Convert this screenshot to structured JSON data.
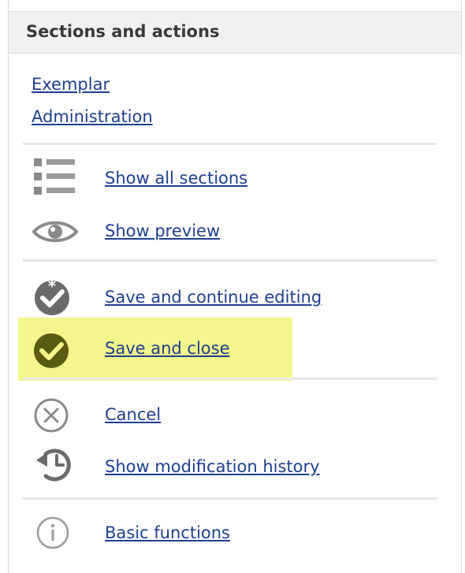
{
  "panel": {
    "title": "Sections and actions"
  },
  "links": {
    "exemplar": "Exemplar",
    "administration": "Administration"
  },
  "actions": {
    "show_all_sections": "Show all sections",
    "show_preview": "Show preview",
    "save_and_continue": "Save and continue editing",
    "save_and_close": "Save and close",
    "cancel": "Cancel",
    "show_modification_history": "Show modification history",
    "basic_functions": "Basic functions"
  },
  "icons": {
    "show_all_sections": "list-icon",
    "show_preview": "eye-icon",
    "save_and_continue": "check-asterisk-icon",
    "save_and_close": "check-circle-icon",
    "cancel": "cancel-circle-icon",
    "show_modification_history": "history-icon",
    "basic_functions": "info-icon"
  },
  "colors": {
    "link": "#1e3f8f",
    "highlight": "#f3f68a",
    "icon_gray": "#8a8a8a",
    "icon_dark": "#5a5a5a"
  },
  "state": {
    "highlighted_action": "Save and close"
  }
}
